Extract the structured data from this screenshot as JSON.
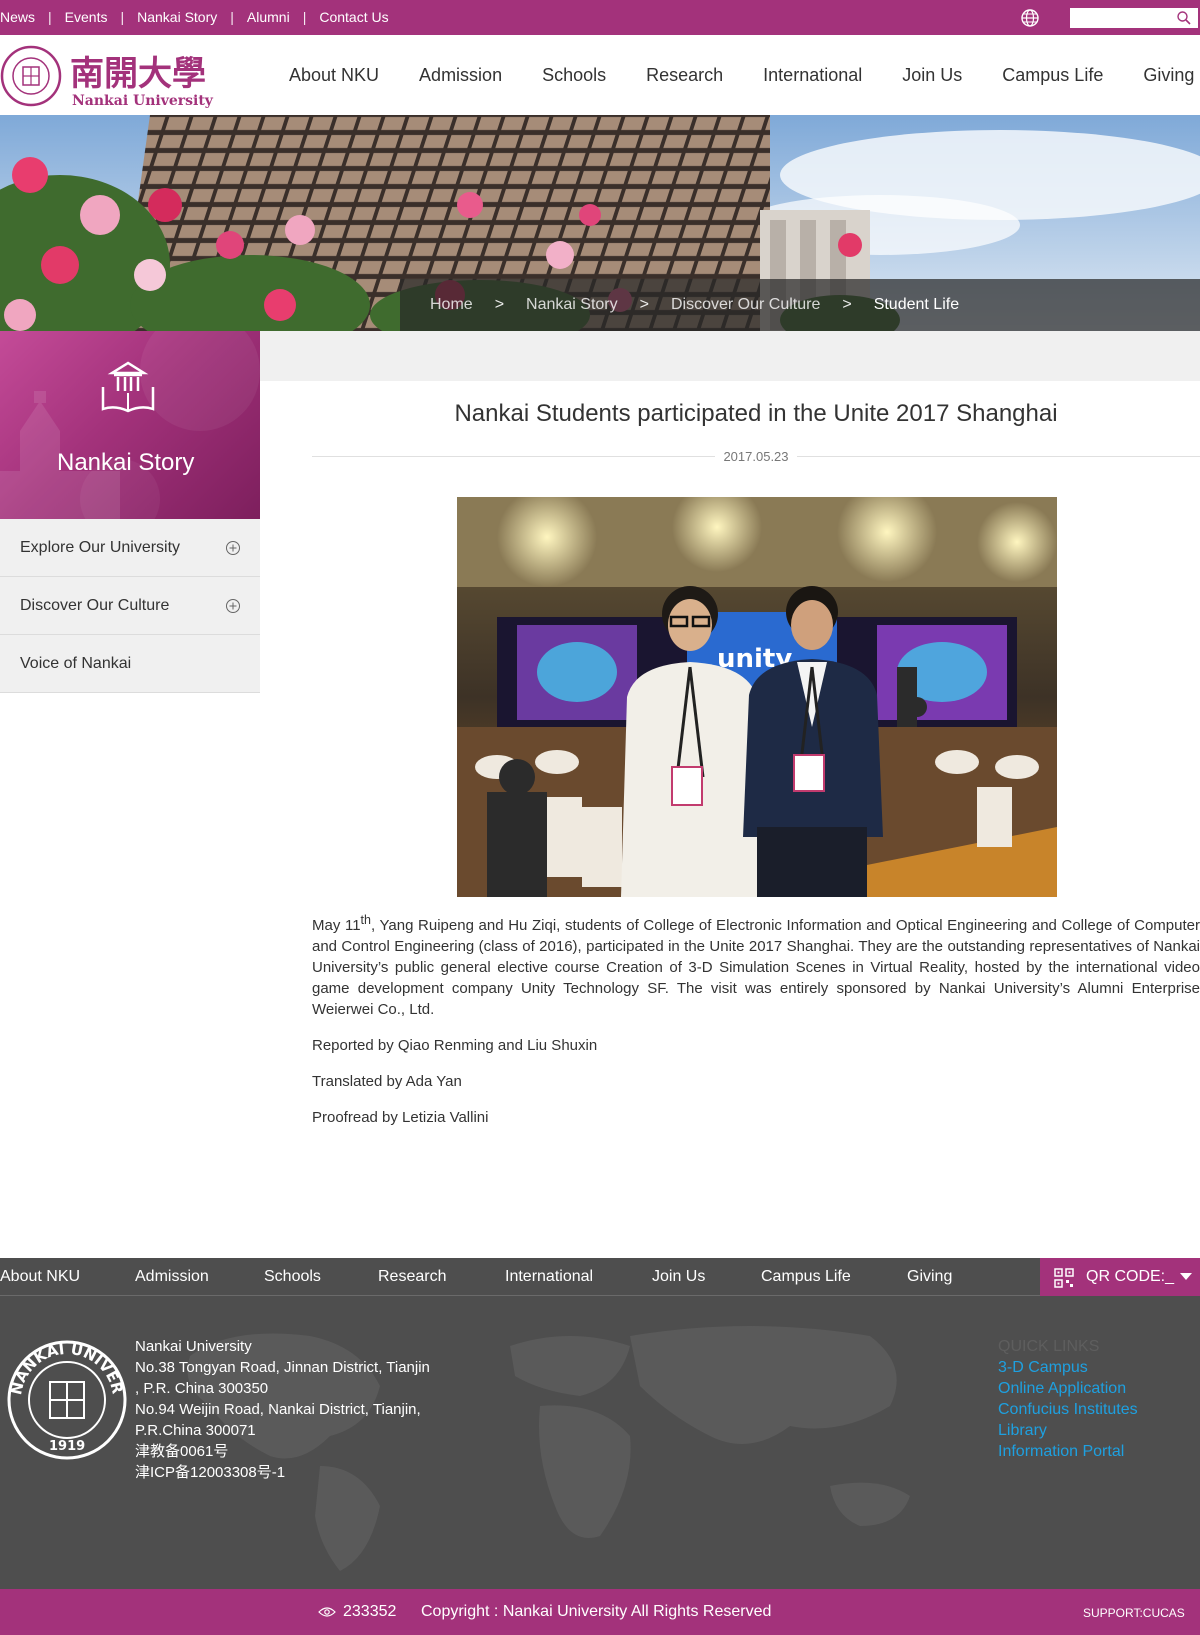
{
  "topbar": {
    "links": [
      "News",
      "Events",
      "Nankai Story",
      "Alumni",
      "Contact Us"
    ],
    "search_placeholder": ""
  },
  "logo": {
    "cn": "南開大學",
    "en": "Nankai University",
    "seal_text": "NANKAI UNIVERSITY",
    "seal_year": "1919"
  },
  "nav": [
    "About NKU",
    "Admission",
    "Schools",
    "Research",
    "International",
    "Join Us",
    "Campus Life",
    "Giving"
  ],
  "breadcrumb": [
    "Home",
    ">",
    "Nankai Story",
    ">",
    "Discover Our Culture",
    ">",
    "Student Life"
  ],
  "sidebar": {
    "title": "Nankai Story",
    "items": [
      {
        "label": "Explore Our University",
        "icon": "plus-circle-icon"
      },
      {
        "label": "Discover Our Culture",
        "icon": "plus-circle-icon"
      },
      {
        "label": "Voice of Nankai"
      }
    ]
  },
  "article": {
    "title": "Nankai Students participated in the Unite 2017 Shanghai",
    "date": "2017.05.23",
    "para1_pre": "May 11",
    "para1_sup": "th",
    "para1_post": ", Yang Ruipeng and Hu Ziqi, students of College of Electronic Information and Optical Engineering and College of Computer and Control Engineering (class of 2016), participated in the Unite 2017 Shanghai. They are the outstanding representatives of Nankai University’s public general elective course Creation of 3-D Simulation Scenes in Virtual Reality, hosted by the international video game development company Unity Technology SF. The visit was entirely sponsored by Nankai University’s Alumni Enterprise Weierwei Co., Ltd.",
    "reported": "Reported by Qiao Renming and Liu Shuxin",
    "translated": "Translated by Ada Yan",
    "proofread": "Proofread by Letizia Vallini",
    "photo_sign": "unity"
  },
  "footer": {
    "nav": [
      "About NKU",
      "Admission",
      "Schools",
      "Research",
      "International",
      "Join Us",
      "Campus Life",
      "Giving"
    ],
    "qr_label": "QR CODE:_",
    "address": [
      "Nankai University",
      "No.38 Tongyan Road, Jinnan District, Tianjin",
      ", P.R. China 300350",
      "No.94 Weijin Road,  Nankai District, Tianjin,",
      "P.R.China  300071",
      "津教备0061号",
      "津ICP备12003308号-1"
    ],
    "quick_links_heading": "QUICK LINKS",
    "quick_links": [
      "3-D Campus",
      "Online Application",
      "Confucius Institutes",
      "Library",
      "Information Portal"
    ],
    "visits": "233352",
    "copyright": "Copyright : Nankai University All Rights Reserved",
    "support": "SUPPORT:CUCAS"
  },
  "colors": {
    "brand": "#a3327b",
    "footer_bg": "#4e4e4e",
    "link": "#1ea0e0"
  }
}
